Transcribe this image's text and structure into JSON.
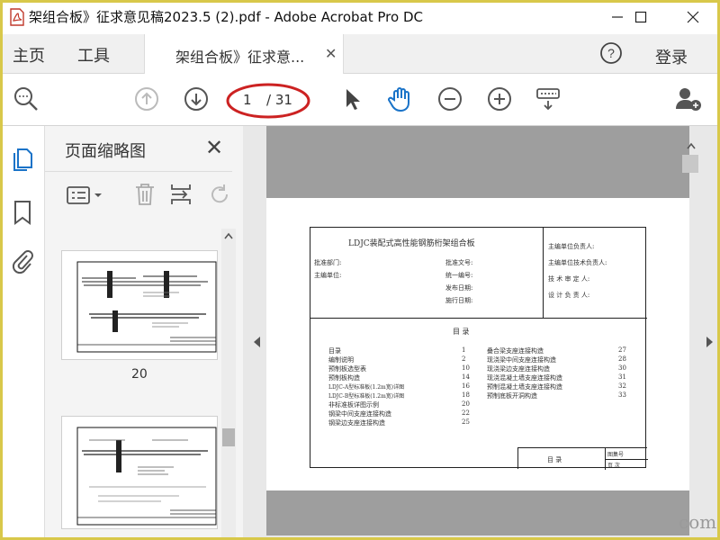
{
  "window": {
    "title": "架组合板》征求意见稿2023.5 (2).pdf - Adobe Acrobat Pro DC"
  },
  "menu": {
    "home": "主页",
    "tools": "工具",
    "tab_label": "架组合板》征求意...",
    "login": "登录"
  },
  "toolbar": {
    "page_current": "1",
    "page_total": "/ 31",
    "highlight_color": "#cc2222"
  },
  "panel": {
    "title": "页面缩略图",
    "thumb_1_label": "20"
  },
  "doc": {
    "sheet_title": "LDJC装配式高性能钢筋桁架组合板",
    "left_fields": [
      "批准部门:",
      "主编单位:"
    ],
    "mid_fields": [
      "批准文号:",
      "统一编号:",
      "发布日期:",
      "施行日期:"
    ],
    "right_fields": [
      "主编单位负责人:",
      "主编单位技术负责人:",
      "技 术 审 定 人:",
      "设 计 负 责 人:"
    ],
    "toc_heading": "目        录",
    "toc_left": [
      {
        "t": "目录",
        "p": "1"
      },
      {
        "t": "编制说明",
        "p": "2"
      },
      {
        "t": "预制板选型表",
        "p": "10"
      },
      {
        "t": "预制板构造",
        "p": "14"
      },
      {
        "t": "LDJC-A型标准板(1.2m宽)详图",
        "p": "16"
      },
      {
        "t": "LDJC-B型标准板(1.2m宽)详图",
        "p": "18"
      },
      {
        "t": "非标准板详图示例",
        "p": "20"
      },
      {
        "t": "钢梁中间支座连接构造",
        "p": "22"
      },
      {
        "t": "钢梁边支座连接构造",
        "p": "25"
      }
    ],
    "toc_right": [
      {
        "t": "叠合梁支座连接构造",
        "p": "27"
      },
      {
        "t": "现浇梁中间支座连接构造",
        "p": "28"
      },
      {
        "t": "现浇梁边支座连接构造",
        "p": "30"
      },
      {
        "t": "现浇混凝土墙支座连接构造",
        "p": "31"
      },
      {
        "t": "预制混凝土墙支座连接构造",
        "p": "32"
      },
      {
        "t": "预制底板开洞构造",
        "p": "33"
      }
    ],
    "footer_label": "目        录",
    "footer_code": "图集号",
    "footer_page": "页  次"
  },
  "watermark": "com"
}
